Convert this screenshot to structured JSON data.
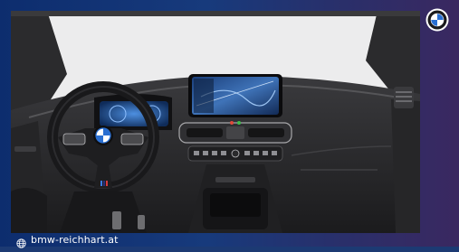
{
  "image": {
    "subject": "bmw-ix3-interior-cockpit",
    "brand_logo": "bmw-roundel-icon",
    "colors": {
      "frame_left": "#0d2d6e",
      "frame_right": "#3a2860",
      "dashboard": "#2a2a2c",
      "background": "#e9e9ea",
      "accent_blue": "#2a6fd1"
    }
  },
  "footer": {
    "icon": "globe-icon",
    "url": "bmw-reichhart.at"
  }
}
